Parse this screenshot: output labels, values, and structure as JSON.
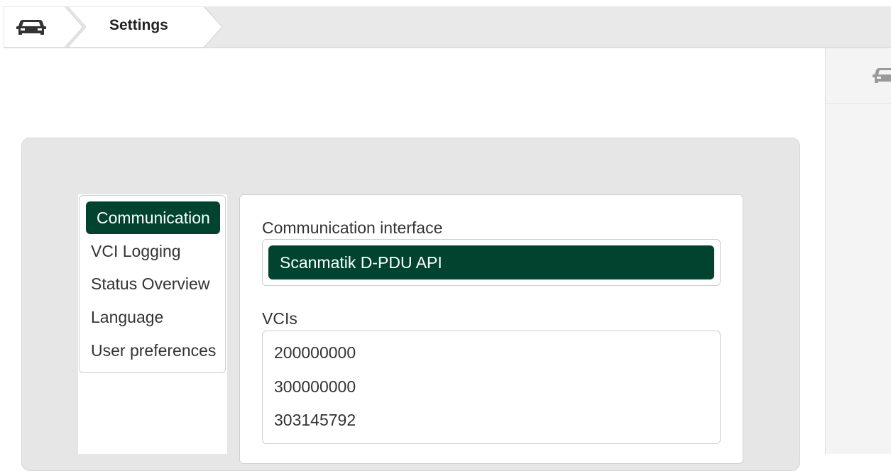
{
  "breadcrumb": {
    "home_icon": "car-icon",
    "current_label": "Settings"
  },
  "side_panel": {
    "icon": "car-icon"
  },
  "nav": {
    "items": [
      {
        "label": "Communication",
        "active": true
      },
      {
        "label": "VCI Logging",
        "active": false
      },
      {
        "label": "Status Overview",
        "active": false
      },
      {
        "label": "Language",
        "active": false
      },
      {
        "label": "User preferences",
        "active": false
      }
    ]
  },
  "communication": {
    "interface_label": "Communication interface",
    "interface_selected": "Scanmatik D-PDU API",
    "vcis_label": "VCIs",
    "vcis": [
      "200000000",
      "300000000",
      "303145792"
    ]
  },
  "colors": {
    "accent": "#004430",
    "bar_background": "#e9e9e9",
    "panel_background": "#e6e6e6"
  }
}
